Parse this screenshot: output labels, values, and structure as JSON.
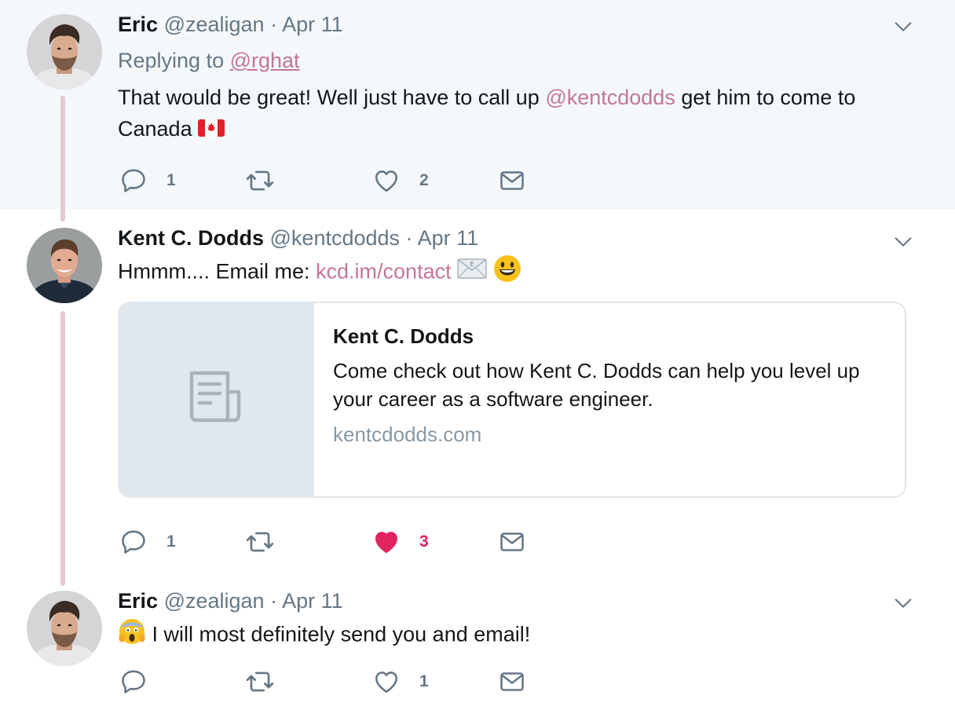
{
  "tweets": [
    {
      "author_name": "Eric",
      "handle": "@zealigan",
      "separator": "·",
      "date": "Apr 11",
      "replying_prefix": "Replying to",
      "replying_to": "@rghat",
      "text_before": "That would be great! Well just have to call up",
      "mention": "@kentcdodds",
      "text_after": "get him to come to Canada",
      "emoji": "flag-canada",
      "reply_count": "1",
      "retweet_count": "",
      "like_count": "2",
      "liked": false
    },
    {
      "author_name": "Kent C. Dodds",
      "handle": "@kentcdodds",
      "separator": "·",
      "date": "Apr 11",
      "text_before": "Hmmm.... Email me:",
      "link": "kcd.im/contact",
      "emojis": [
        "envelope",
        "smiley"
      ],
      "card": {
        "title": "Kent C. Dodds",
        "description": "Come check out how Kent C. Dodds can help you level up your career as a software engineer.",
        "domain": "kentcdodds.com",
        "thumb_icon": "document-icon"
      },
      "reply_count": "1",
      "retweet_count": "",
      "like_count": "3",
      "liked": true
    },
    {
      "author_name": "Eric",
      "handle": "@zealigan",
      "separator": "·",
      "date": "Apr 11",
      "emoji": "face-screaming",
      "text": "I will most definitely send you and email!",
      "reply_count": "",
      "retweet_count": "",
      "like_count": "1",
      "liked": false
    }
  ],
  "colors": {
    "link": "#c3759a",
    "muted": "#657786",
    "liked": "#e0245e",
    "thread_line": "#e6c8d3",
    "highlight_bg": "#f5f8fa"
  }
}
